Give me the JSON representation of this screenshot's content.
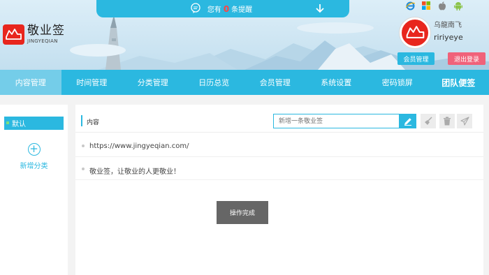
{
  "notice": {
    "prefix": "您有",
    "count": "0",
    "suffix": "条提醒"
  },
  "logo": {
    "cn": "敬业签",
    "en": "JINGYEQIAN"
  },
  "user": {
    "name_cn": "乌龍南飞",
    "name_en": "ririyeye"
  },
  "buttons": {
    "member": "会员管理",
    "logout": "退出登录"
  },
  "platform_icons": [
    "ie-icon",
    "windows-icon",
    "apple-icon",
    "android-icon"
  ],
  "nav": [
    {
      "label": "内容管理",
      "active": true
    },
    {
      "label": "时间管理"
    },
    {
      "label": "分类管理"
    },
    {
      "label": "日历总览"
    },
    {
      "label": "会员管理"
    },
    {
      "label": "系统设置"
    },
    {
      "label": "密码锁屏"
    },
    {
      "label": "团队便签",
      "bold": true
    }
  ],
  "sidebar": {
    "default_label": "默认",
    "add_label": "新增分类",
    "add_symbol": "+"
  },
  "main": {
    "title": "内容",
    "input_placeholder": "新增一条敬业签",
    "notes": [
      "https://www.jingyeqian.com/",
      "敬业签，让敬业的人更敬业！"
    ]
  },
  "toast": "操作完成",
  "colors": {
    "accent": "#2bb8e0",
    "brand_red": "#e8261d",
    "logout": "#f0627a",
    "nav_active": "#74cde9"
  }
}
